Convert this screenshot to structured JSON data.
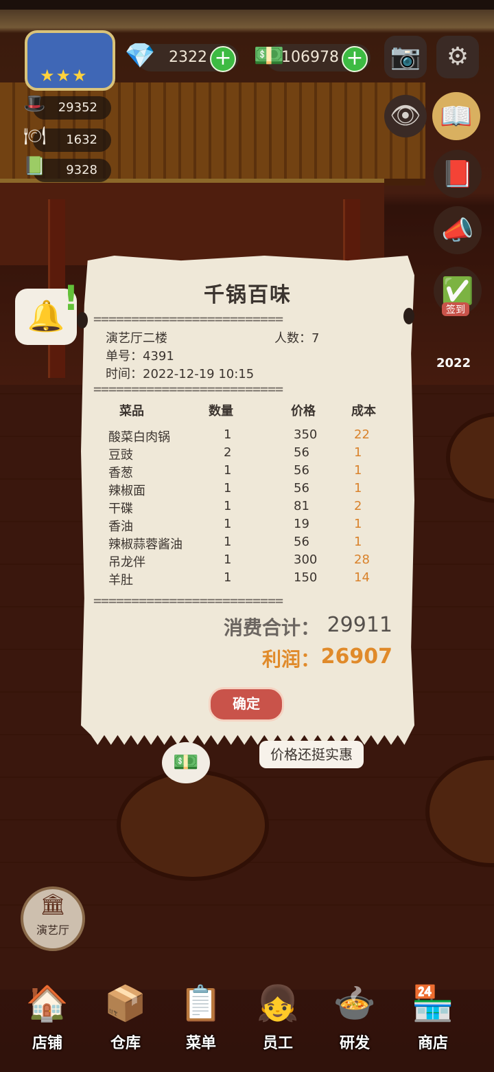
{
  "hud": {
    "gems": "2322",
    "cash": "106978",
    "stats": [
      "29352",
      "1632",
      "9328"
    ]
  },
  "receipt": {
    "title": "千锅百味",
    "separator": "=========================",
    "location": "演艺厅二楼",
    "people": "人数：7",
    "order_no": "单号：4391",
    "time": "时间：2022-12-19 10:15",
    "headers": [
      "菜品",
      "数量",
      "价格",
      "成本"
    ],
    "items": [
      {
        "name": "酸菜白肉锅",
        "qty": "1",
        "price": "350",
        "cost": "22"
      },
      {
        "name": "豆豉",
        "qty": "2",
        "price": "56",
        "cost": "1"
      },
      {
        "name": "香葱",
        "qty": "1",
        "price": "56",
        "cost": "1"
      },
      {
        "name": "辣椒面",
        "qty": "1",
        "price": "56",
        "cost": "1"
      },
      {
        "name": "干碟",
        "qty": "1",
        "price": "81",
        "cost": "2"
      },
      {
        "name": "香油",
        "qty": "1",
        "price": "19",
        "cost": "1"
      },
      {
        "name": "辣椒蒜蓉酱油",
        "qty": "1",
        "price": "56",
        "cost": "1"
      },
      {
        "name": "吊龙伴",
        "qty": "1",
        "price": "300",
        "cost": "28"
      },
      {
        "name": "羊肚",
        "qty": "1",
        "price": "150",
        "cost": "14"
      }
    ],
    "total_label": "消费合计：",
    "total_value": "29911",
    "profit_label": "利润：",
    "profit_value": "26907",
    "confirm_label": "确定"
  },
  "speech": "价格还挺实惠",
  "badge_2022": "2022",
  "checkin_label": "签到",
  "room_label": "演艺厅",
  "nav": [
    {
      "label": "店铺",
      "icon": "shop-icon"
    },
    {
      "label": "仓库",
      "icon": "warehouse-icon"
    },
    {
      "label": "菜单",
      "icon": "menu-icon"
    },
    {
      "label": "员工",
      "icon": "staff-icon"
    },
    {
      "label": "研发",
      "icon": "research-icon"
    },
    {
      "label": "商店",
      "icon": "store-icon"
    }
  ],
  "colors": {
    "profit": "#e08a2a",
    "confirm": "#c9534a",
    "plus": "#3dbb43"
  }
}
